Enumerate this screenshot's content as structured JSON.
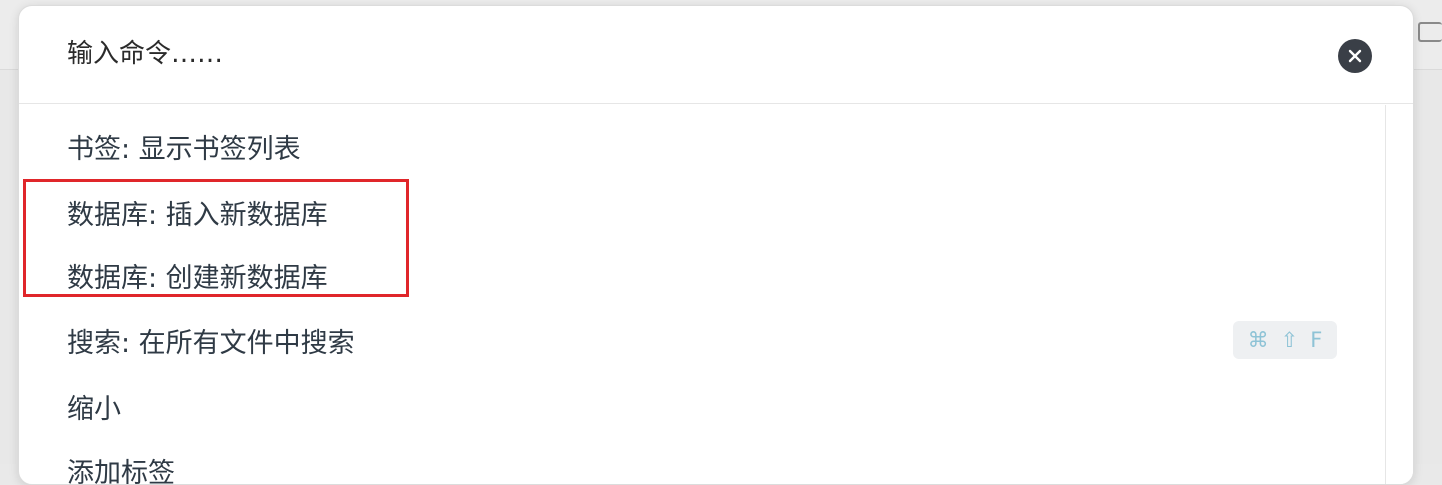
{
  "palette": {
    "input": {
      "placeholder": "输入命令……",
      "value": ""
    },
    "close_icon": "close-icon",
    "items": [
      {
        "label": "书签: 显示书签列表"
      },
      {
        "label": "数据库: 插入新数据库"
      },
      {
        "label": "数据库: 创建新数据库"
      },
      {
        "label": "搜索: 在所有文件中搜索",
        "hotkey": [
          "⌘",
          "⇧",
          "F"
        ]
      },
      {
        "label": "缩小"
      },
      {
        "label": "添加标签"
      }
    ]
  },
  "colors": {
    "highlight": "#e0262a",
    "close_button": "#3a3f47",
    "text": "#2f3a45",
    "hotkey_text": "#8ec3d6"
  }
}
